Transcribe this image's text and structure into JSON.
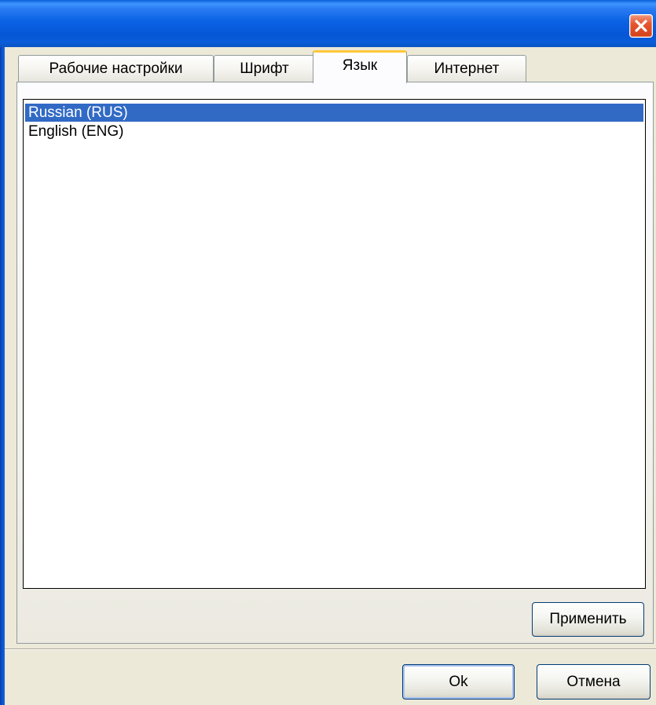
{
  "window": {
    "title": "",
    "close_icon": "close-icon",
    "close_color": "#e5562f",
    "titlebar_color": "#0a62e3"
  },
  "tabs": [
    {
      "label": "Рабочие настройки",
      "active": false
    },
    {
      "label": "Шрифт",
      "active": false
    },
    {
      "label": "Язык",
      "active": true
    },
    {
      "label": "Интернет",
      "active": false
    }
  ],
  "language_list": {
    "items": [
      {
        "label": "Russian (RUS)",
        "selected": true
      },
      {
        "label": "English (ENG)",
        "selected": false
      }
    ],
    "selection_color": "#316ac5"
  },
  "buttons": {
    "apply_label": "Применить",
    "ok_label": "Ok",
    "cancel_label": "Отмена"
  }
}
